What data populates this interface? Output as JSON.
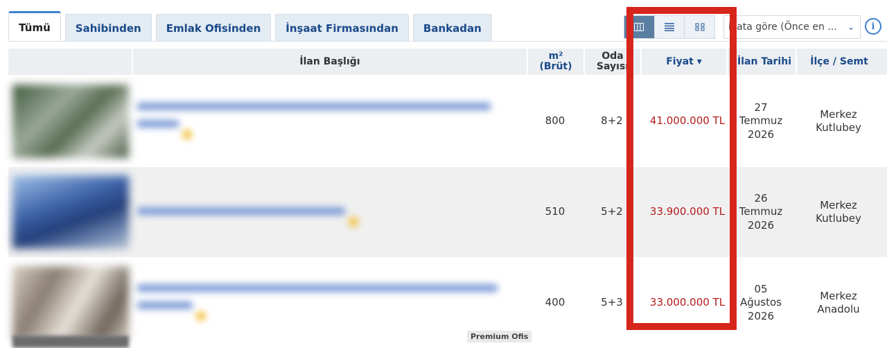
{
  "tabs": [
    {
      "label": "Tümü",
      "active": true
    },
    {
      "label": "Sahibinden",
      "active": false
    },
    {
      "label": "Emlak Ofisinden",
      "active": false
    },
    {
      "label": "İnşaat Firmasından",
      "active": false
    },
    {
      "label": "Bankadan",
      "active": false
    }
  ],
  "toolbar": {
    "view_options": [
      "table-view-icon",
      "list-view-icon",
      "grid-view-icon"
    ],
    "active_view": "table-view-icon",
    "sort_value": "iyata göre (Önce en ...",
    "info_glyph": "i"
  },
  "columns": {
    "title": "İlan Başlığı",
    "area_line1": "m²",
    "area_line2": "(Brüt)",
    "rooms_line1": "Oda",
    "rooms_line2": "Sayısı",
    "price": "Fiyat ▾",
    "date": "İlan Tarihi",
    "district": "İlçe / Semt"
  },
  "rows": [
    {
      "area": "800",
      "rooms": "8+2",
      "price": "41.000.000 TL",
      "date_day": "27",
      "date_month": "Temmuz",
      "date_year": "2026",
      "district_1": "Merkez",
      "district_2": "Kutlubey"
    },
    {
      "area": "510",
      "rooms": "5+2",
      "price": "33.900.000 TL",
      "date_day": "26",
      "date_month": "Temmuz",
      "date_year": "2026",
      "district_1": "Merkez",
      "district_2": "Kutlubey"
    },
    {
      "area": "400",
      "rooms": "5+3",
      "price": "33.000.000 TL",
      "date_day": "05",
      "date_month": "Ağustos",
      "date_year": "2026",
      "district_1": "Merkez",
      "district_2": "Anadolu"
    }
  ],
  "badges": {
    "premium": "Premium Ofis"
  },
  "colors": {
    "price": "#b31b1b",
    "highlight": "#d6261c",
    "link": "#1a4a8a",
    "active_view": "#5b7ea3"
  }
}
